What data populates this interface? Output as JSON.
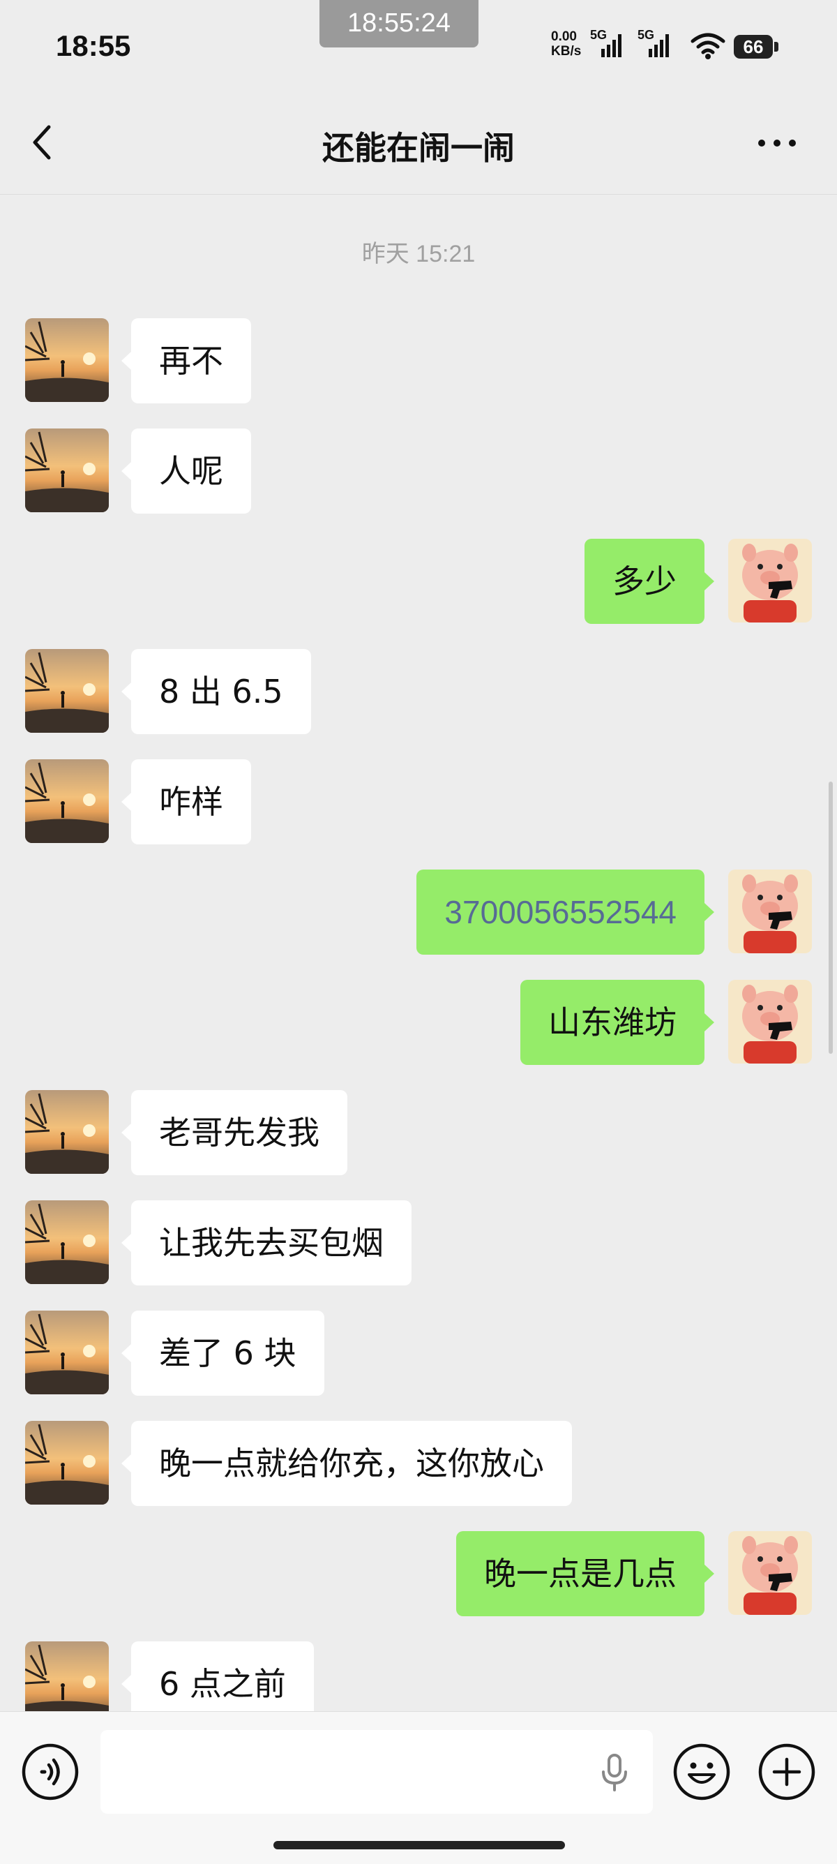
{
  "status_bar": {
    "time": "18:55",
    "recording_time": "18:55:24",
    "net_speed": "0.00",
    "net_unit": "KB/s",
    "signal1_label": "5G",
    "signal2_label": "5G",
    "battery": "66"
  },
  "header": {
    "title": "还能在闹一闹",
    "back_icon": "chevron-left-icon",
    "more_icon": "more-dots-icon"
  },
  "chat": {
    "timestamp": "昨天 15:21",
    "messages": [
      {
        "side": "in",
        "text": "再不"
      },
      {
        "side": "in",
        "text": "人呢"
      },
      {
        "side": "out",
        "text": "多少"
      },
      {
        "side": "in",
        "text": "8 出 6.5"
      },
      {
        "side": "in",
        "text": "咋样"
      },
      {
        "side": "out",
        "text": "3700056552544",
        "link": true
      },
      {
        "side": "out",
        "text": "山东潍坊"
      },
      {
        "side": "in",
        "text": "老哥先发我"
      },
      {
        "side": "in",
        "text": "让我先去买包烟"
      },
      {
        "side": "in",
        "text": "差了 6 块"
      },
      {
        "side": "in",
        "text": "晚一点就给你充，这你放心"
      },
      {
        "side": "out",
        "text": "晚一点是几点"
      },
      {
        "side": "in",
        "text": "6 点之前"
      }
    ]
  },
  "input_bar": {
    "text_value": "",
    "icons": [
      "voice-icon",
      "mic-icon",
      "emoji-icon",
      "plus-icon"
    ]
  },
  "colors": {
    "background": "#ededed",
    "incoming_bubble": "#ffffff",
    "outgoing_bubble": "#95ec69",
    "link_text": "#576b95"
  }
}
